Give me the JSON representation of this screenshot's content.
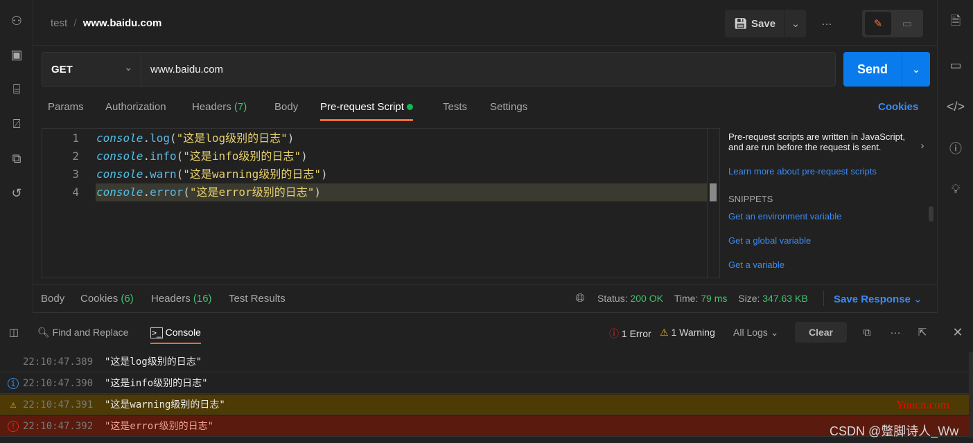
{
  "left_sidebar": {
    "icons": [
      "collections-icon",
      "apis-icon",
      "environments-icon",
      "monitors-icon",
      "flows-icon",
      "history-icon"
    ]
  },
  "right_sidebar": {
    "icons": [
      "documentation-icon",
      "comments-icon",
      "code-icon",
      "info-icon",
      "lightbulb-icon"
    ]
  },
  "breadcrumb": {
    "parent": "test",
    "separator": "/",
    "current": "www.baidu.com"
  },
  "header": {
    "save_label": "Save"
  },
  "request": {
    "method": "GET",
    "url": "www.baidu.com",
    "send_label": "Send"
  },
  "tabs": [
    {
      "label": "Params"
    },
    {
      "label": "Authorization"
    },
    {
      "label": "Headers",
      "count": "(7)"
    },
    {
      "label": "Body"
    },
    {
      "label": "Pre-request Script",
      "active": true
    },
    {
      "label": "Tests"
    },
    {
      "label": "Settings"
    }
  ],
  "cookies_label": "Cookies",
  "editor": {
    "lines": [
      {
        "num": "1",
        "obj": "console",
        "method": "log",
        "arg": "\"这是log级别的日志\""
      },
      {
        "num": "2",
        "obj": "console",
        "method": "info",
        "arg": "\"这是info级别的日志\""
      },
      {
        "num": "3",
        "obj": "console",
        "method": "warn",
        "arg": "\"这是warning级别的日志\""
      },
      {
        "num": "4",
        "obj": "console",
        "method": "error",
        "arg": "\"这是error级别的日志\""
      }
    ]
  },
  "help": {
    "text": "Pre-request scripts are written in JavaScript, and are run before the request is sent.",
    "link": "Learn more about pre-request scripts",
    "snippets_title": "SNIPPETS",
    "snippets": [
      "Get an environment variable",
      "Get a global variable",
      "Get a variable"
    ]
  },
  "response": {
    "tabs": [
      {
        "label": "Body"
      },
      {
        "label": "Cookies",
        "count": "(6)"
      },
      {
        "label": "Headers",
        "count": "(16)"
      },
      {
        "label": "Test Results"
      }
    ],
    "status_label": "Status:",
    "status": "200 OK",
    "time_label": "Time:",
    "time": "79 ms",
    "size_label": "Size:",
    "size": "347.63 KB",
    "save_response": "Save Response"
  },
  "console": {
    "find_replace": "Find and Replace",
    "console_tab": "Console",
    "errors": "1 Error",
    "warnings": "1 Warning",
    "filter": "All Logs",
    "clear": "Clear",
    "rows": [
      {
        "level": "log",
        "time": "22:10:47.389",
        "message": "\"这是log级别的日志\""
      },
      {
        "level": "info",
        "time": "22:10:47.390",
        "message": "\"这是info级别的日志\""
      },
      {
        "level": "warning",
        "time": "22:10:47.391",
        "message": "\"这是warning级别的日志\""
      },
      {
        "level": "error",
        "time": "22:10:47.392",
        "message": "\"这是error级别的日志\""
      }
    ]
  },
  "watermarks": [
    "Yuucn.com",
    "CSDN @蹩脚诗人_Ww"
  ],
  "colors": {
    "accent": "#ff6c37",
    "send": "#097bed",
    "link": "#3a8bf5",
    "success": "#3fc56b",
    "warning_bg": "#4d3a05",
    "error_bg": "#5a1a0d"
  }
}
